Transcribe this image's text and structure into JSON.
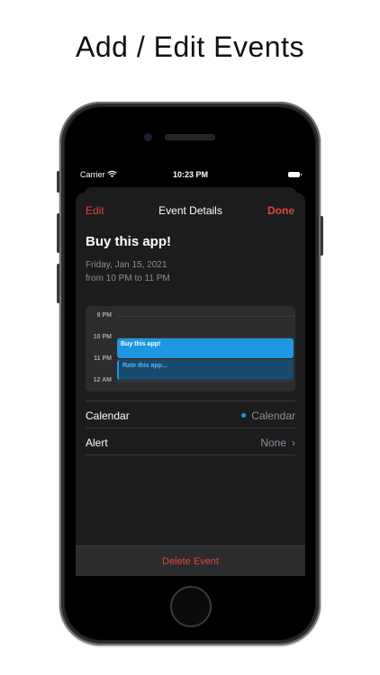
{
  "headline": "Add / Edit Events",
  "status_bar": {
    "carrier": "Carrier",
    "time": "10:23 PM"
  },
  "nav": {
    "edit_label": "Edit",
    "title": "Event Details",
    "done_label": "Done"
  },
  "event": {
    "title": "Buy this app!",
    "date": "Friday, Jan 15, 2021",
    "time_range": "from 10 PM to 11 PM"
  },
  "day_view": {
    "hours": [
      "9 PM",
      "10 PM",
      "11 PM",
      "12 AM"
    ],
    "events": [
      {
        "title": "Buy this app!"
      },
      {
        "title": "Rate this app..."
      }
    ]
  },
  "details": {
    "calendar_label": "Calendar",
    "calendar_value": "Calendar",
    "alert_label": "Alert",
    "alert_value": "None"
  },
  "delete_label": "Delete Event",
  "colors": {
    "accent": "#e0443e",
    "calendar_blue": "#1d98e0",
    "background": "#1c1c1e"
  }
}
